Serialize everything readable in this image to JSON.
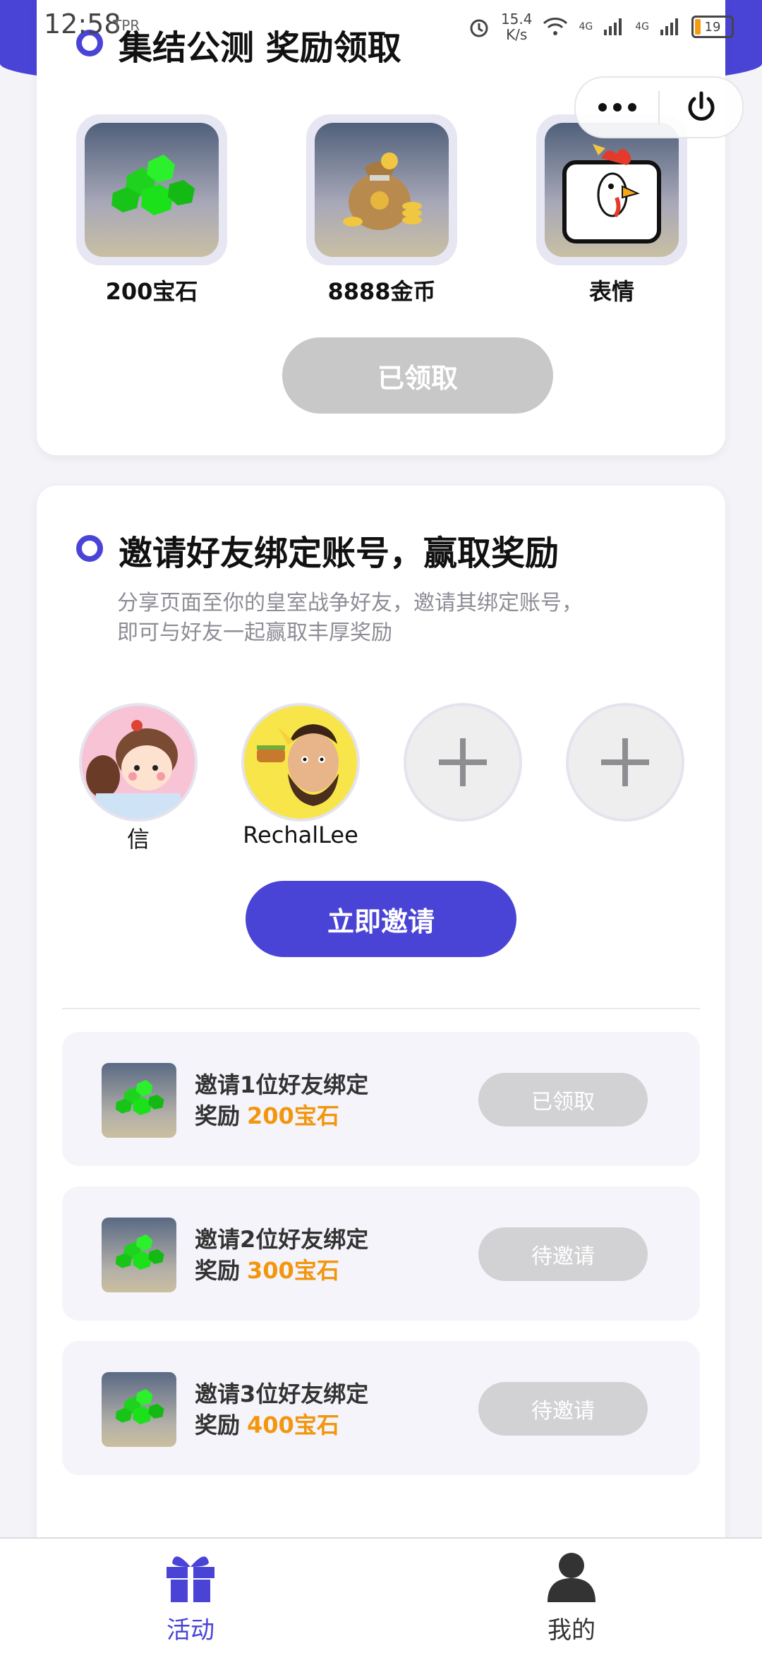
{
  "status_bar": {
    "time": "12:58",
    "mini_label": "TPR",
    "speed_value": "15.4",
    "speed_unit": "K/s",
    "signal_1": "4G",
    "signal_2": "4G",
    "battery": "19"
  },
  "miniapp_capsule": {
    "more_icon": "more-dots-icon",
    "close_icon": "power-icon"
  },
  "section1": {
    "title": "集结公测 奖励领取",
    "rewards": [
      {
        "label": "200宝石",
        "icon": "gems-icon"
      },
      {
        "label": "8888金币",
        "icon": "coin-bag-icon"
      },
      {
        "label": "表情",
        "icon": "chicken-emote-icon"
      }
    ],
    "claim_button": "已领取"
  },
  "section2": {
    "title": "邀请好友绑定账号，赢取奖励",
    "description_line1": "分享页面至你的皇室战争好友，邀请其绑定账号，",
    "description_line2": "即可与好友一起赢取丰厚奖励",
    "friends": [
      {
        "name": "信"
      },
      {
        "name": "RechalLee"
      },
      {
        "name": ""
      },
      {
        "name": ""
      }
    ],
    "invite_button": "立即邀请",
    "tasks": [
      {
        "title": "邀请1位好友绑定",
        "reward_prefix": "奖励",
        "reward_amount": "200宝石",
        "button": "已领取"
      },
      {
        "title": "邀请2位好友绑定",
        "reward_prefix": "奖励",
        "reward_amount": "300宝石",
        "button": "待邀请"
      },
      {
        "title": "邀请3位好友绑定",
        "reward_prefix": "奖励",
        "reward_amount": "400宝石",
        "button": "待邀请"
      }
    ]
  },
  "bottom_nav": {
    "items": [
      {
        "label": "活动",
        "icon": "gift-icon",
        "active": true
      },
      {
        "label": "我的",
        "icon": "user-icon",
        "active": false
      }
    ]
  },
  "colors": {
    "accent": "#4a44d6",
    "reward_orange": "#f2960e",
    "disabled_gray": "#c8c8c8"
  }
}
